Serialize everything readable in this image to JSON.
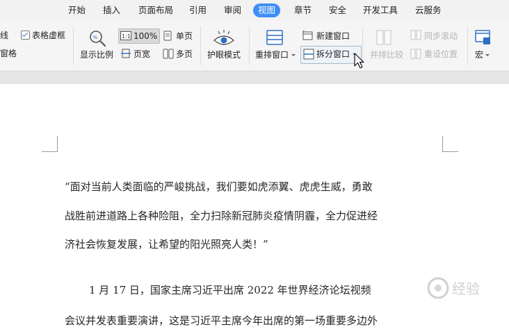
{
  "menu": {
    "items": [
      "开始",
      "插入",
      "页面布局",
      "引用",
      "审阅",
      "视图",
      "章节",
      "安全",
      "开发工具",
      "云服务"
    ],
    "active": "视图"
  },
  "ribbon": {
    "gridline_partial": "线",
    "table_gridlines_label": "表格虚框",
    "window_partial": "窗格",
    "zoom_label": "显示比例",
    "zoom_100_label": "100%",
    "page_width_label": "页宽",
    "single_page_label": "单页",
    "multi_page_label": "多页",
    "eye_protection_label": "护眼模式",
    "arrange_window_label": "重排窗口",
    "new_window_label": "新建窗口",
    "split_window_label": "拆分窗口",
    "side_by_side_label": "并排比较",
    "sync_scroll_label": "同步滚动",
    "reset_position_label": "重设位置",
    "macro_label": "宏"
  },
  "document": {
    "lines": [
      "“面对当前人类面临的严峻挑战，我们要如虎添翼、虎虎生威，勇敢",
      "战胜前进道路上各种险阻，全力扫除新冠肺炎疫情阴霾，全力促进经",
      "济社会恢复发展，让希望的阳光照亮人类！”",
      "1 月 17 日，国家主席习近平出席 2022 年世界经济论坛视频",
      "会议并发表重要演讲，这是习近平主席今年出席的第一场重要多边外"
    ]
  },
  "watermark": {
    "text": "经验"
  },
  "colors": {
    "accent": "#3e8ef7",
    "icon_blue": "#2d6fc4",
    "disabled": "#b4b4b4"
  }
}
